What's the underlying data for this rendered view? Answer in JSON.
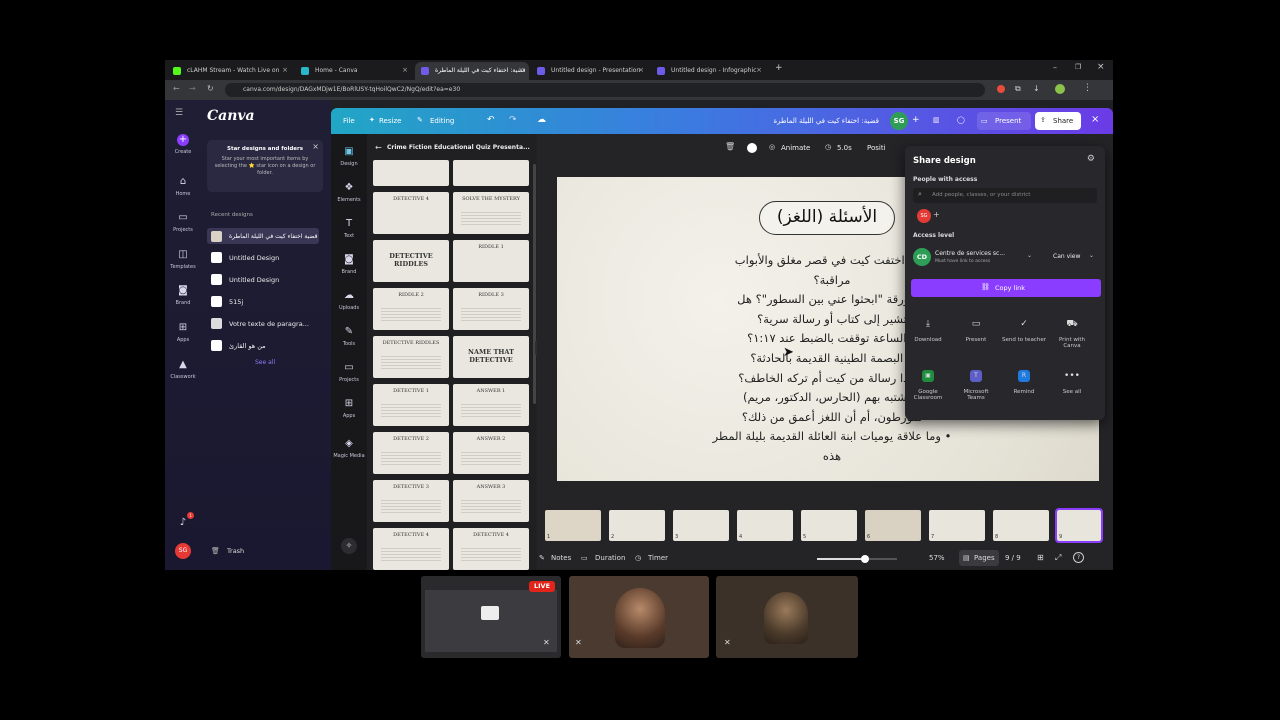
{
  "browser": {
    "tabs": [
      {
        "label": "cLAHM Stream - Watch Live on"
      },
      {
        "label": "Home - Canva"
      },
      {
        "label": "قضية: اختفاء كيت في الليلة الماطرة"
      },
      {
        "label": "Untitled design - Presentation"
      },
      {
        "label": "Untitled design - Infographic"
      }
    ],
    "url": "canva.com/design/DAGxMDjw1E/BoRlUSY-tqHoilQwC2/NgQ/edit?ea=e30"
  },
  "canva": {
    "logo": "Canva",
    "rail": [
      "Create",
      "Home",
      "Projects",
      "Templates",
      "Brand",
      "Apps",
      "Classwork"
    ],
    "star_tip": {
      "title": "Star designs and folders",
      "body": "Star your most important items by selecting the ⭐ star icon on a design or folder."
    },
    "recent_heading": "Recent designs",
    "recent": [
      "قضية اختفاء كيت في الليلة الماطرة",
      "Untitled Design",
      "Untitled Design",
      "515j",
      "Votre texte de paragra...",
      "من هو القارئ"
    ],
    "see_all": "See all",
    "trash": "Trash",
    "avatar": "SG",
    "notif_count": "1"
  },
  "topbar": {
    "file": "File",
    "resize": "Resize",
    "editing": "Editing",
    "doc_title": "قضية: اختفاء كيت في الليلة الماطرة",
    "avatar": "SG",
    "present": "Present",
    "share": "Share"
  },
  "tools": [
    "Design",
    "Elements",
    "Text",
    "Brand",
    "Uploads",
    "Tools",
    "Projects",
    "Apps",
    "Magic Media"
  ],
  "panel": {
    "title": "Crime Fiction Educational Quiz Presenta...",
    "thumbs": [
      "",
      "",
      "DETECTIVE 4",
      "SOLVE THE MYSTERY",
      "DETECTIVE RIDDLES",
      "RIDDLE 1",
      "RIDDLE 2",
      "RIDDLE 3",
      "DETECTIVE RIDDLES",
      "NAME THAT DETECTIVE",
      "DETECTIVE 1",
      "ANSWER 1",
      "DETECTIVE 2",
      "ANSWER 2",
      "DETECTIVE 3",
      "ANSWER 3",
      "DETECTIVE 4",
      "DETECTIVE 4"
    ]
  },
  "context_toolbar": {
    "animate": "Animate",
    "duration": "5.0s",
    "position": "Positi"
  },
  "slide": {
    "title": "الأسئلة (اللغز)",
    "lines": [
      "كيف اختفت كيت في قصر مغلق والأبواب",
      "مراقبة؟",
      "• الورقة \"ابحثوا عني بين السطور\"؟ هل",
      "تشير إلى كتاب أو رسالة سرية؟",
      "• الساعة توقفت بالضبط عند ١:١٧؟",
      "• البصمة الطينية القديمة بالحادثة؟",
      "• هذا رسالة من كيت أم تركه الخاطف؟",
      "• تشتبه بهم (الحارس، الدكتور، مريم)",
      "متورطون، أم أن اللغز أعمق من ذلك؟",
      "• وما علاقة يوميات ابنة العائلة القديمة بليلة المطر",
      "هذه"
    ]
  },
  "share": {
    "title": "Share design",
    "people_label": "People with access",
    "add_placeholder": "Add people, classes, or your district",
    "avatar": "SG",
    "access_label": "Access level",
    "org_initials": "CD",
    "org_name": "Centre de services sc...",
    "org_sub": "Must have link to access",
    "can_view": "Can view",
    "copy_link": "Copy link",
    "actions": [
      {
        "label": "Download",
        "icon": "download-icon"
      },
      {
        "label": "Present",
        "icon": "present-icon"
      },
      {
        "label": "Send to teacher",
        "icon": "send-icon"
      },
      {
        "label": "Print with Canva",
        "icon": "truck-icon"
      },
      {
        "label": "Google Classroom",
        "icon": "classroom-icon"
      },
      {
        "label": "Microsoft Teams",
        "icon": "teams-icon"
      },
      {
        "label": "Remind",
        "icon": "remind-icon"
      },
      {
        "label": "See all",
        "icon": "more-icon"
      }
    ]
  },
  "filmstrip": [
    "1",
    "2",
    "3",
    "4",
    "5",
    "6",
    "7",
    "8",
    "9"
  ],
  "footer": {
    "notes": "Notes",
    "duration": "Duration",
    "timer": "Timer",
    "zoom": "57%",
    "pages": "Pages",
    "page_count": "9 / 9",
    "zoom_level": 0.6
  },
  "meeting": {
    "live_badge": "LIVE"
  },
  "colors": {
    "accent": "#7d2ae8",
    "copy_link_bg": "#8b3dff",
    "live_red": "#e1251b"
  }
}
